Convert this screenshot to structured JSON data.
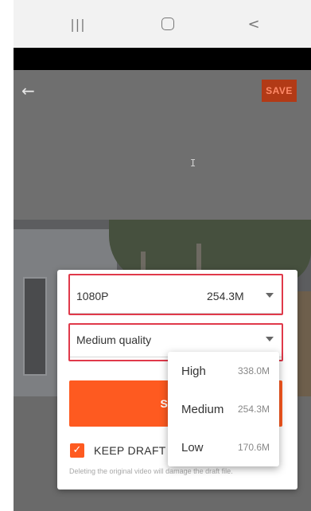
{
  "system_nav": {
    "recent_glyph": "|||",
    "back_glyph": "<"
  },
  "toolbar": {
    "back_glyph": "←",
    "save_label": "SAVE"
  },
  "dialog": {
    "resolution": {
      "label": "1080P",
      "size": "254.3M"
    },
    "quality": {
      "label": "Medium quality"
    },
    "save_label": "SAVE",
    "keep_draft_label": "KEEP DRAFT",
    "keep_draft_checked": true,
    "note": "Deleting the original video will damage the draft file.",
    "accent_color": "#fe5a20",
    "highlight_color": "#e0394a"
  },
  "quality_menu": {
    "items": [
      {
        "label": "High",
        "size": "338.0M"
      },
      {
        "label": "Medium",
        "size": "254.3M"
      },
      {
        "label": "Low",
        "size": "170.6M"
      }
    ]
  }
}
